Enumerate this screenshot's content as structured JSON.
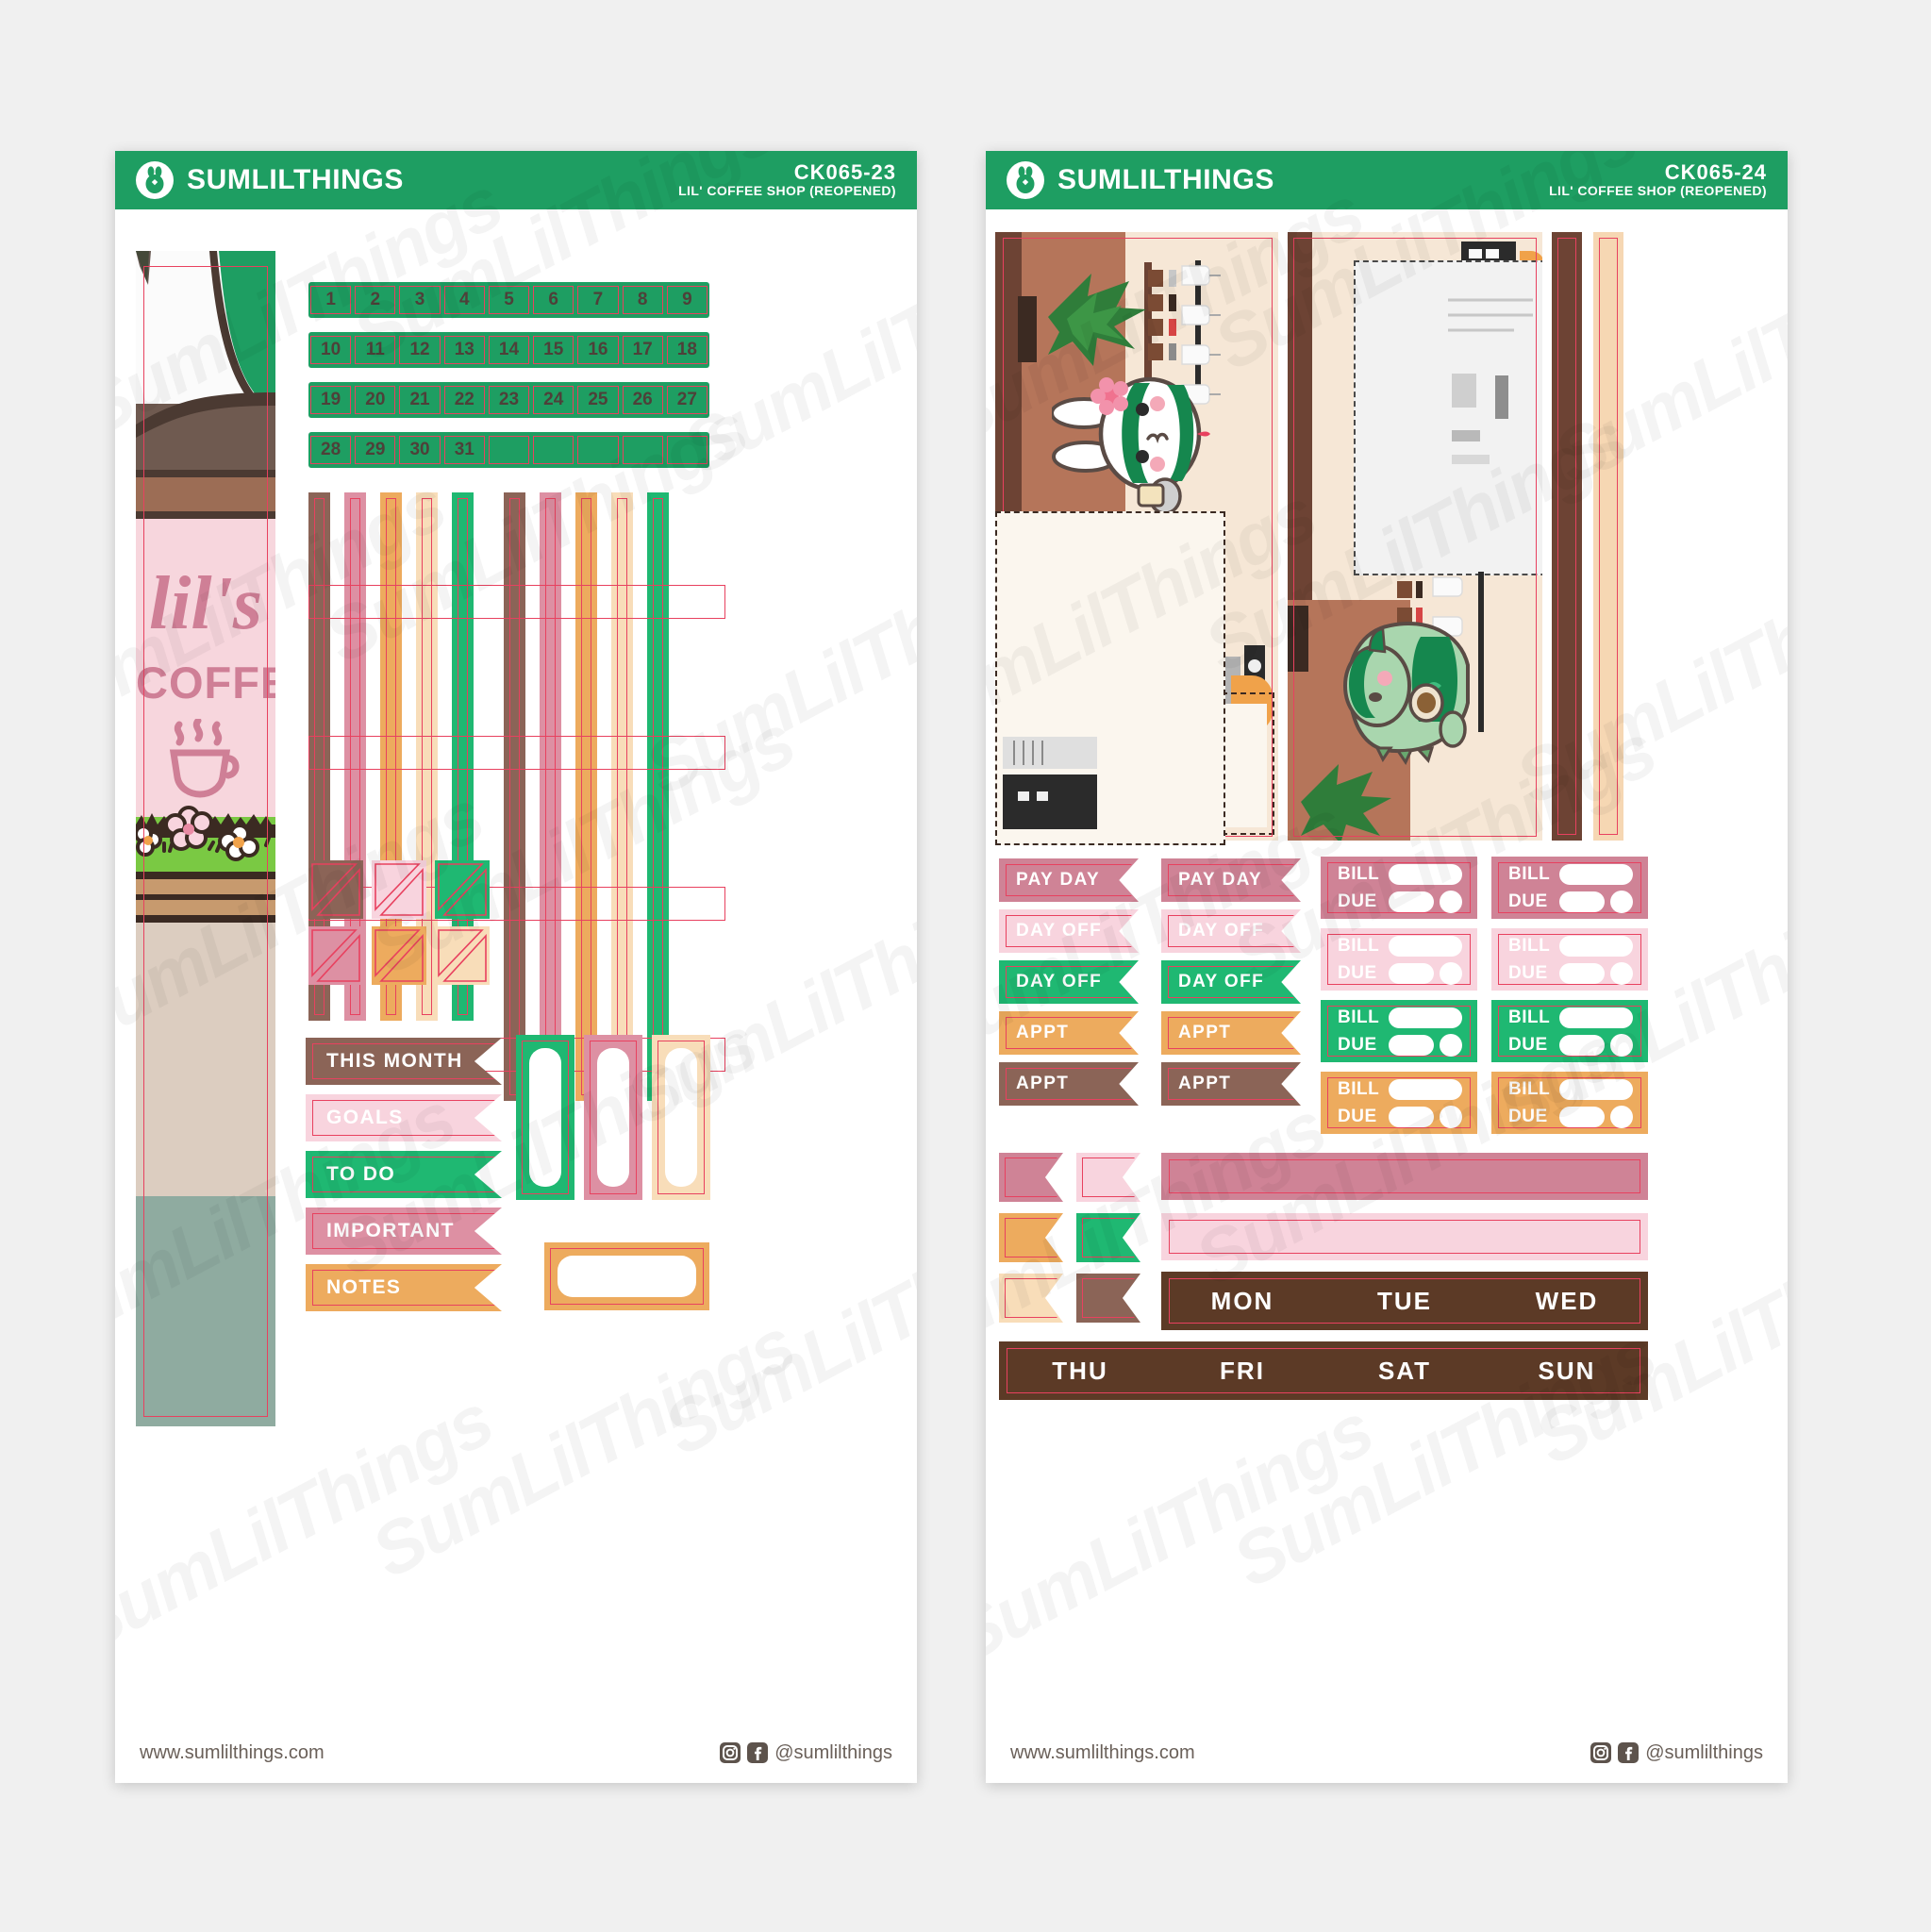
{
  "meta": {
    "brand": "SUMLILTHINGS",
    "website": "www.sumlilthings.com",
    "social_handle": "@sumlilthings",
    "logo_icon": "bunny-logo-icon",
    "instagram_icon": "instagram-icon",
    "facebook_icon": "facebook-icon"
  },
  "sheets": [
    {
      "id": "CK065-23",
      "code": "CK065-23",
      "collection": "LIL' COFFEE SHOP (REOPENED)"
    },
    {
      "id": "CK065-24",
      "code": "CK065-24",
      "collection": "LIL' COFFEE SHOP (REOPENED)"
    }
  ],
  "left_sheet": {
    "date_numbers": [
      [
        "1",
        "2",
        "3",
        "4",
        "5",
        "6",
        "7",
        "8",
        "9"
      ],
      [
        "10",
        "11",
        "12",
        "13",
        "14",
        "15",
        "16",
        "17",
        "18"
      ],
      [
        "19",
        "20",
        "21",
        "22",
        "23",
        "24",
        "25",
        "26",
        "27"
      ],
      [
        "28",
        "29",
        "30",
        "31",
        "",
        "",
        "",
        "",
        ""
      ]
    ],
    "date_row_color": "#1e9e62",
    "shop_sign": {
      "script_text": "lil's",
      "block_text": "COFFEE",
      "cup_icon": "coffee-cup-icon",
      "flower_icon": "flower-icon",
      "awning_color": "#1e9e62",
      "sign_bg": "#f6d4dc",
      "sign_text_color": "#cf7f96"
    },
    "washi_colors": [
      "#8b6457",
      "#dd90a3",
      "#eda köz",
      "#f7d9b4",
      "#1fb872"
    ],
    "washi_strip_colors": [
      "#8b6457",
      "#dd90a3",
      "#edab5e",
      "#f8ddb9",
      "#1fb872",
      "#8b6457",
      "#dd90a3",
      "#edab5e",
      "#f8ddb9",
      "#1fb872"
    ],
    "corner_triangle_colors": [
      "#8b6457",
      "#f8d4de",
      "#1fb872",
      "#dd90a3",
      "#edab5e",
      "#f8ddb9"
    ],
    "banners": [
      {
        "label": "THIS MONTH",
        "bg": "#8b6457"
      },
      {
        "label": "GOALS",
        "bg": "#f8d4de"
      },
      {
        "label": "TO DO",
        "bg": "#1fb872"
      },
      {
        "label": "IMPORTANT",
        "bg": "#dd90a3"
      },
      {
        "label": "NOTES",
        "bg": "#edab5e"
      }
    ],
    "frame_boxes": [
      {
        "color": "#1fb872",
        "shape": "tall"
      },
      {
        "color": "#dd90a3",
        "shape": "tall"
      },
      {
        "color": "#f8ddb9",
        "shape": "tall"
      },
      {
        "color": "#edab5e",
        "shape": "wide"
      }
    ]
  },
  "right_sheet": {
    "scene": {
      "bunny_barista": "bunny-barista-icon",
      "dino_barista": "dino-barista-icon",
      "plant_icon": "plant-icon",
      "espresso_machine_icon": "espresso-machine-icon",
      "cup_shelf_icon": "cup-shelf-icon",
      "counter_color": "#b5755a",
      "wall_color": "#f6e7d6",
      "dark_wood": "#6d4334"
    },
    "event_flags": [
      {
        "label": "PAY DAY",
        "bg": "#cf8396"
      },
      {
        "label": "PAY DAY",
        "bg": "#cf8396"
      },
      {
        "label": "DAY OFF",
        "bg": "#f8d4de"
      },
      {
        "label": "DAY OFF",
        "bg": "#f8d4de"
      },
      {
        "label": "DAY OFF",
        "bg": "#1fb872"
      },
      {
        "label": "DAY OFF",
        "bg": "#1fb872"
      },
      {
        "label": "APPT",
        "bg": "#edab5e"
      },
      {
        "label": "APPT",
        "bg": "#edab5e"
      },
      {
        "label": "APPT",
        "bg": "#8b6457"
      },
      {
        "label": "APPT",
        "bg": "#8b6457"
      }
    ],
    "bill_cards": {
      "bill_label": "BILL",
      "due_label": "DUE",
      "colors": [
        "#cf8396",
        "#cf8396",
        "#f8d4de",
        "#f8d4de",
        "#1fb872",
        "#1fb872",
        "#edab5e",
        "#edab5e"
      ]
    },
    "mini_flag_colors": [
      "#cf8396",
      "#f8d4de",
      "#edab5e",
      "#1fb872",
      "#f8ddb9",
      "#8b6457"
    ],
    "long_bar_colors": [
      "#cf8396",
      "#f8d4de"
    ],
    "weekdays_row1": [
      "MON",
      "TUE",
      "WED"
    ],
    "weekdays_row2": [
      "THU",
      "FRI",
      "SAT",
      "SUN"
    ],
    "weekday_bar_color": "#5c3a26"
  },
  "watermark_text": "SumLilThings"
}
